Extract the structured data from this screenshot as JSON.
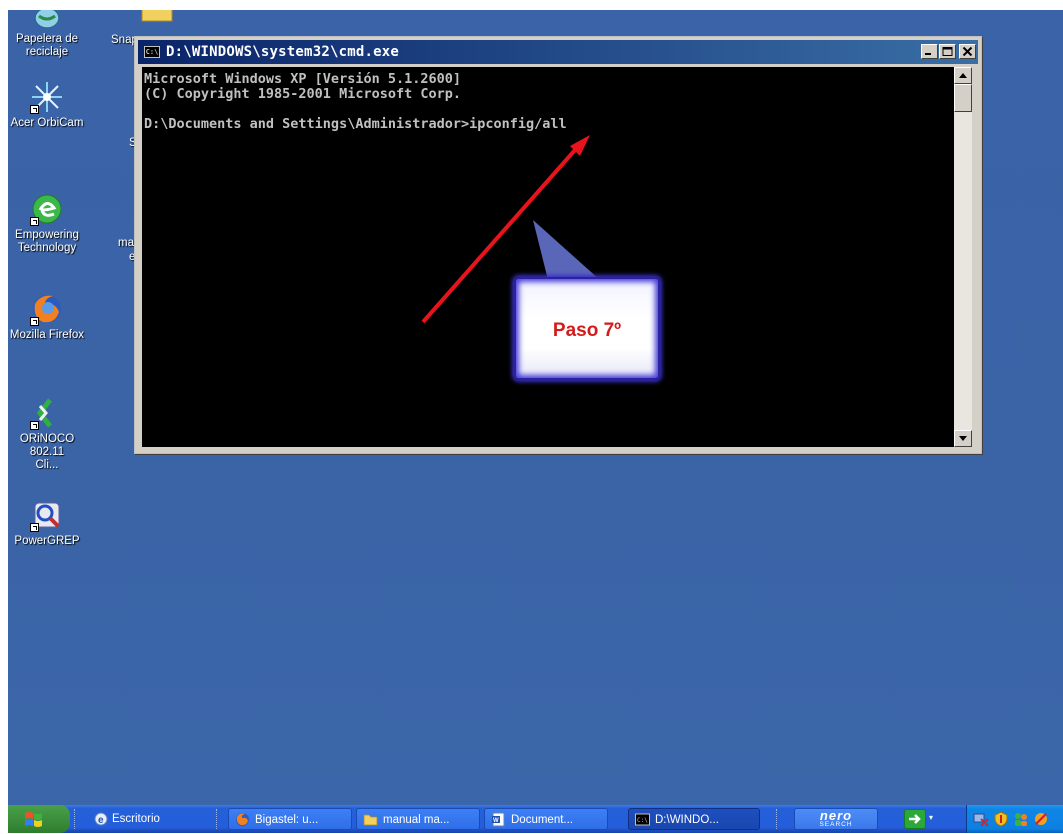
{
  "desktop": {
    "icons": [
      {
        "label": "Papelera de reciclaje"
      },
      {
        "label": "Acer OrbiCam"
      },
      {
        "label": "Empowering Technology"
      },
      {
        "label": "Mozilla Firefox"
      },
      {
        "label": "ORiNOCO 802.11 Cli..."
      },
      {
        "label": "PowerGREP"
      }
    ],
    "partial_labels": [
      "Snap",
      "S",
      "ma",
      "e"
    ]
  },
  "cmd_window": {
    "title": "D:\\WINDOWS\\system32\\cmd.exe",
    "icon_text": "C:\\",
    "console_lines": [
      "Microsoft Windows XP [Versión 5.1.2600]",
      "(C) Copyright 1985-2001 Microsoft Corp.",
      "",
      "D:\\Documents and Settings\\Administrador>ipconfig/all"
    ]
  },
  "annotation": {
    "callout_text": "Paso 7º",
    "arrow_color": "#e8141c"
  },
  "taskbar": {
    "items": [
      {
        "label": "Escritorio",
        "icon": "desktop-icon"
      },
      {
        "label": "Bigastel: u...",
        "icon": "firefox-icon"
      },
      {
        "label": "manual ma...",
        "icon": "folder-icon"
      },
      {
        "label": "Document...",
        "icon": "word-icon"
      },
      {
        "label": "D:\\WINDO...",
        "icon": "cmd-icon",
        "active": true
      }
    ],
    "nero_line1": "nero",
    "nero_line2": "SEARCH"
  },
  "colors": {
    "desktop_bg": "#3a64a6",
    "taskbar_bg": "#245edb",
    "titlebar_start": "#0a246a",
    "titlebar_end": "#3a6ea5",
    "console_bg": "#000000",
    "console_text": "#c0c0c0",
    "callout_text": "#d41a1a"
  }
}
